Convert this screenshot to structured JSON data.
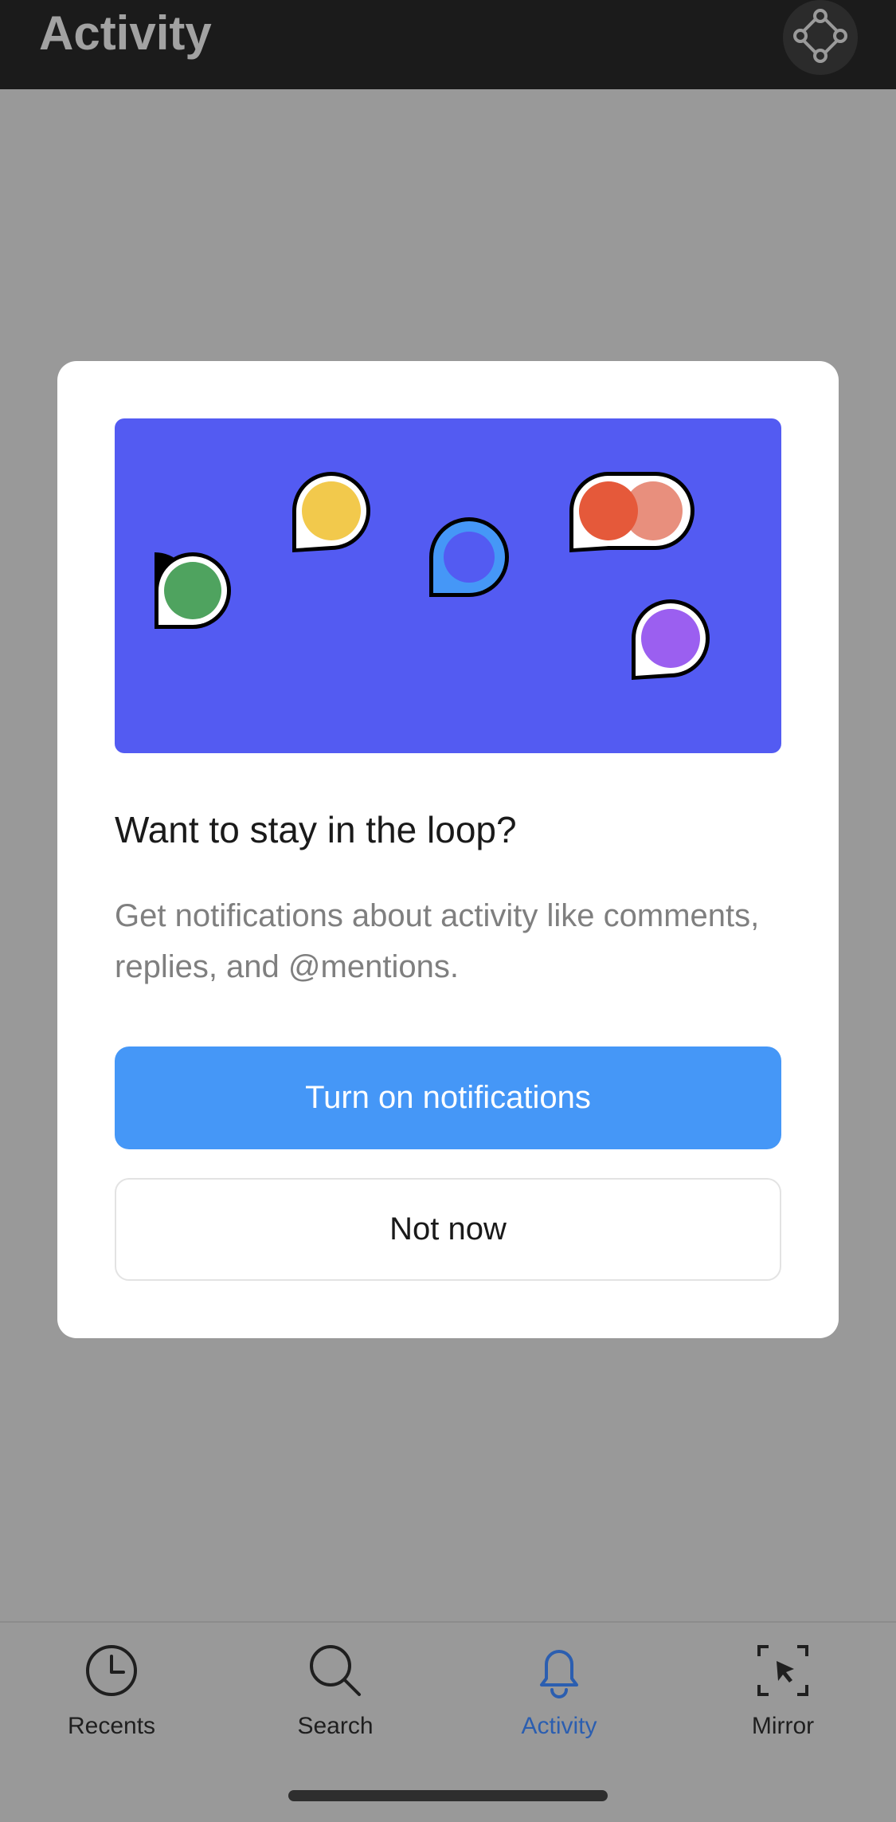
{
  "header": {
    "title": "Activity",
    "action_icon": "component-diamond-icon"
  },
  "modal": {
    "illustration_bg": "#535bf2",
    "title": "Want to stay in the loop?",
    "body": "Get notifications about activity like comments, replies, and @mentions.",
    "primary_button": "Turn on notifications",
    "secondary_button": "Not now",
    "avatar_colors": [
      "#4fa35f",
      "#f2c94c",
      "#4597f7",
      "#e5593a",
      "#e88f7d",
      "#9b5ff0"
    ]
  },
  "tabbar": {
    "items": [
      {
        "label": "Recents",
        "icon": "clock-icon",
        "active": false
      },
      {
        "label": "Search",
        "icon": "search-icon",
        "active": false
      },
      {
        "label": "Activity",
        "icon": "bell-icon",
        "active": true
      },
      {
        "label": "Mirror",
        "icon": "mirror-icon",
        "active": false
      }
    ]
  },
  "colors": {
    "accent": "#4597f7",
    "active_tab": "#2b5eb0",
    "overlay": "#999999"
  }
}
